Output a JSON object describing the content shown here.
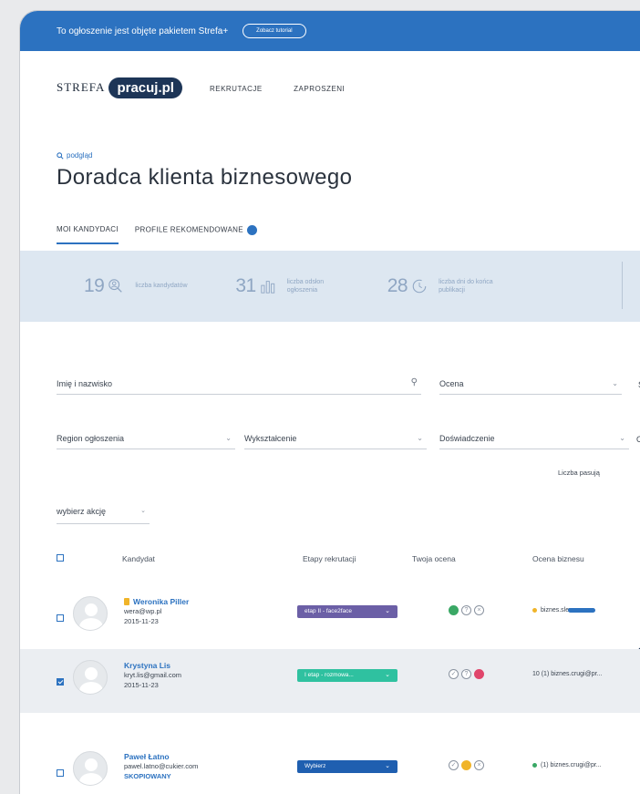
{
  "banner": {
    "text": "To ogłoszenie jest objęte pakietem Strefa+",
    "tutorial_button": "Zobacz tutorial"
  },
  "header": {
    "logo_prefix": "STREFA",
    "logo_brand": "pracuj.pl",
    "nav": [
      "REKRUTACJE",
      "ZAPROSZENI"
    ]
  },
  "page": {
    "search_link": "podgląd",
    "title": "Doradca klienta biznesowego"
  },
  "tabs": [
    {
      "label": "MOI KANDYDACI",
      "active": true
    },
    {
      "label": "PROFILE REKOMENDOWANE",
      "active": false
    }
  ],
  "stats": [
    {
      "value": "19",
      "label": "liczba kandydatów",
      "icon": "people-search-icon"
    },
    {
      "value": "31",
      "label": "liczba odsłon ogłoszenia",
      "icon": "bar-chart-icon"
    },
    {
      "value": "28",
      "label": "liczba dni do końca publikacji",
      "icon": "clock-icon"
    }
  ],
  "filters": {
    "name_placeholder": "Imię i nazwisko",
    "rating": "Ocena",
    "col3_partial": "St",
    "region": "Region ogłoszenia",
    "education": "Wykształcenie",
    "experience": "Doświadczenie",
    "col4_partial": "O"
  },
  "sort_note": "Liczba pasują",
  "actions": {
    "label": "wybierz akcję"
  },
  "table": {
    "headers": {
      "candidate": "Kandydat",
      "stages": "Etapy rekrutacji",
      "your_rating": "Twoja ocena",
      "business_rating": "Ocena biznesu"
    },
    "rows": [
      {
        "name": "Weronika Piller",
        "email": "wera@wp.pl",
        "date": "2015-11-23",
        "extra": "",
        "checked": false,
        "stage": "etap II - face2face",
        "stage_color": "#6b5fa6",
        "business": "biznes.slew"
      },
      {
        "name": "Krystyna Lis",
        "email": "kryt.lis@gmail.com",
        "date": "2015-11-23",
        "extra": "",
        "checked": true,
        "stage": "I etap - rozmowa...",
        "stage_color": "#2fc1a0",
        "business": "10 (1) biznes.crugi@pr..."
      },
      {
        "name": "Paweł Łatno",
        "email": "pawel.latno@cukier.com",
        "date": "",
        "extra": "SKOPIOWANY",
        "checked": false,
        "stage": "Wybierz",
        "stage_color": "#1f5fb0",
        "business": "(1) biznes.crugi@pr..."
      }
    ]
  },
  "colors": {
    "accent": "#2c72c0",
    "banner": "#2c72c0",
    "stats_bg": "#dde7f1",
    "selected_row": "#ebeef2"
  }
}
